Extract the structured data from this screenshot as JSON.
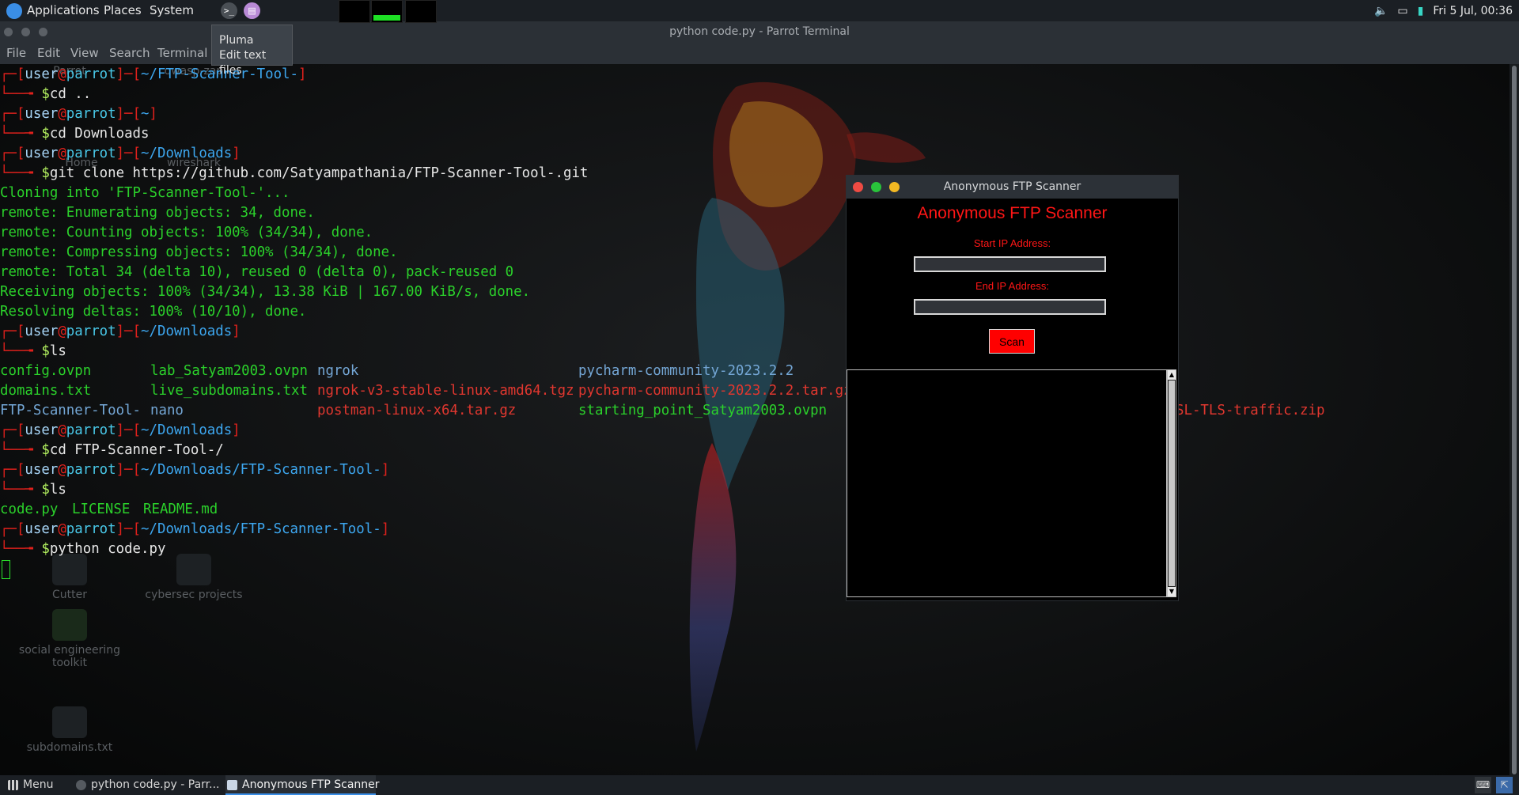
{
  "top_panel": {
    "applications": "Applications",
    "places": "Places",
    "system": "System",
    "clock": "Fri 5 Jul, 00:36"
  },
  "tooltip": {
    "title": "Pluma",
    "description": "Edit text files"
  },
  "terminal": {
    "title": "python code.py - Parrot Terminal",
    "menu": [
      "File",
      "Edit",
      "View",
      "Search",
      "Terminal",
      "Help"
    ],
    "user": "user",
    "host": "parrot",
    "lines": [
      {
        "path": "~/FTP-Scanner-Tool-",
        "cmd": "cd .."
      },
      {
        "path": "~",
        "cmd": "cd Downloads"
      },
      {
        "path": "~/Downloads",
        "cmd": "git clone https://github.com/Satyampathania/FTP-Scanner-Tool-.git"
      }
    ],
    "git_output": [
      "Cloning into 'FTP-Scanner-Tool-'...",
      "remote: Enumerating objects: 34, done.",
      "remote: Counting objects: 100% (34/34), done.",
      "remote: Compressing objects: 100% (34/34), done.",
      "remote: Total 34 (delta 10), reused 0 (delta 0), pack-reused 0",
      "Receiving objects: 100% (34/34), 13.38 KiB | 167.00 KiB/s, done.",
      "Resolving deltas: 100% (10/10), done."
    ],
    "ls_path": "~/Downloads",
    "ls_cmd": "ls",
    "ls_files": {
      "config": "config.ovpn",
      "lab": "lab_Satyam2003.ovpn",
      "ngrok": "ngrok",
      "pycharm": "pycharm-community-2023.2.2",
      "domains": "domains.txt",
      "live": "live_subdomains.txt",
      "ngrok_tgz": "ngrok-v3-stable-linux-amd64.tgz",
      "pycharm_tgz": "pycharm-community-2023.2.2.tar.gz",
      "ftp_dir": "FTP-Scanner-Tool-",
      "nano": "nano",
      "postman": "postman-linux-x64.tar.gz",
      "starting": "starting_point_Satyam2003.ovpn",
      "ssl_zip_partial": "SL-TLS-traffic.zip"
    },
    "cd_path": "~/Downloads",
    "cd_cmd": "cd FTP-Scanner-Tool-/",
    "ls2_path": "~/Downloads/FTP-Scanner-Tool-",
    "ls2_cmd": "ls",
    "ls2_files": {
      "code": "code.py",
      "license": "LICENSE",
      "readme": "README.md"
    },
    "run_path": "~/Downloads/FTP-Scanner-Tool-",
    "run_cmd": "python code.py"
  },
  "desktop_icons": [
    {
      "label": "Parrot"
    },
    {
      "label": "owasp-zap"
    },
    {
      "label": "Home"
    },
    {
      "label": "wireshark"
    },
    {
      "label": "Cutter"
    },
    {
      "label": "cybersec projects"
    },
    {
      "label": "social engineering toolkit"
    },
    {
      "label": "subdomains.txt"
    }
  ],
  "ftp_scanner": {
    "window_title": "Anonymous FTP Scanner",
    "heading": "Anonymous FTP Scanner",
    "start_label": "Start IP Address:",
    "start_value": "",
    "end_label": "End IP Address:",
    "end_value": "",
    "scan_button": "Scan",
    "results": ""
  },
  "taskbar": {
    "menu": "Menu",
    "terminal_task": "python code.py - Parr...",
    "ftp_task": "Anonymous FTP Scanner"
  },
  "colors": {
    "prompt_red": "#e0211c",
    "output_green": "#2bd12b",
    "scanner_red": "#ff1616",
    "scan_button": "#ff0000"
  }
}
